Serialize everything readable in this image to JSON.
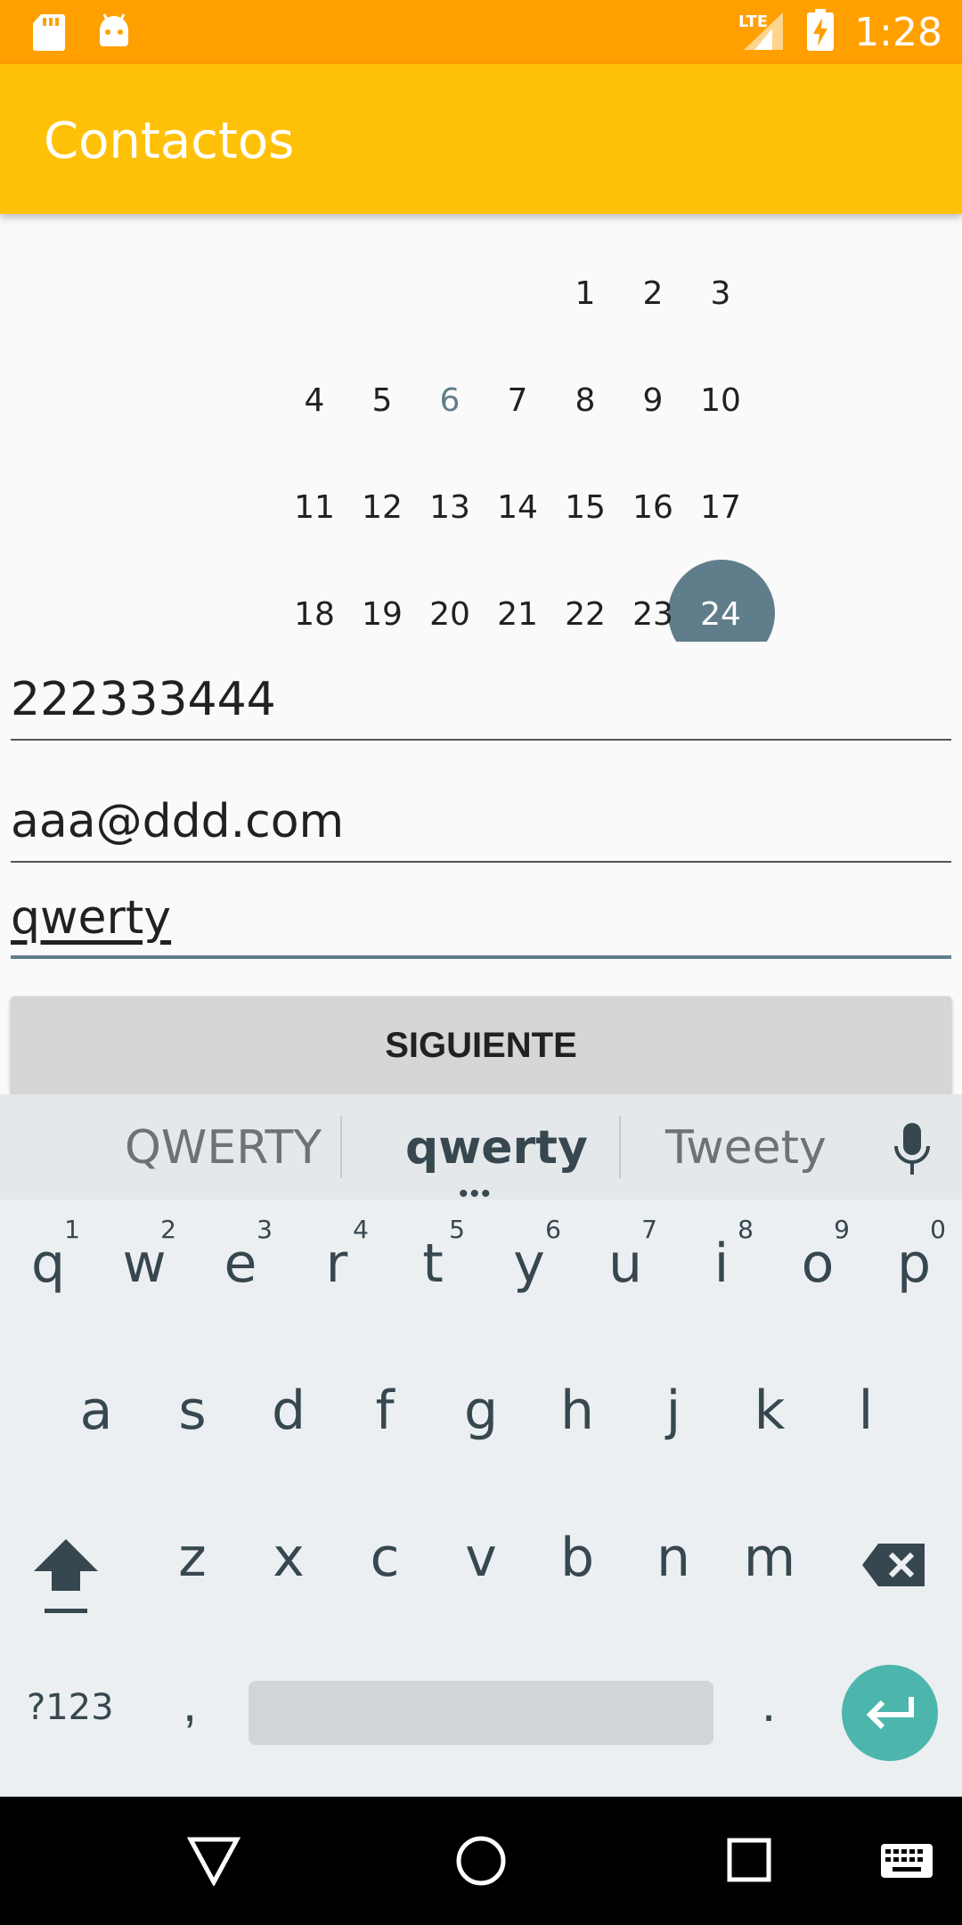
{
  "status_bar": {
    "time": "1:28",
    "network": "LTE",
    "icons": [
      "sd-card-icon",
      "android-icon",
      "signal-icon",
      "battery-charging-icon"
    ]
  },
  "app_bar": {
    "title": "Contactos"
  },
  "calendar": {
    "rows": [
      [
        "",
        "",
        "",
        "",
        "1",
        "2",
        "3"
      ],
      [
        "4",
        "5",
        "6",
        "7",
        "8",
        "9",
        "10"
      ],
      [
        "11",
        "12",
        "13",
        "14",
        "15",
        "16",
        "17"
      ],
      [
        "18",
        "19",
        "20",
        "21",
        "22",
        "23",
        "24"
      ]
    ],
    "today": "6",
    "selected": "24",
    "selected_color": "#607d8b"
  },
  "form": {
    "phone_value": "222333444",
    "email_value": "aaa@ddd.com",
    "description_value": "qwerty",
    "next_label": "SIGUIENTE"
  },
  "keyboard": {
    "suggestions": [
      "QWERTY",
      "qwerty",
      "Tweety"
    ],
    "row1": [
      {
        "l": "q",
        "h": "1"
      },
      {
        "l": "w",
        "h": "2"
      },
      {
        "l": "e",
        "h": "3"
      },
      {
        "l": "r",
        "h": "4"
      },
      {
        "l": "t",
        "h": "5"
      },
      {
        "l": "y",
        "h": "6"
      },
      {
        "l": "u",
        "h": "7"
      },
      {
        "l": "i",
        "h": "8"
      },
      {
        "l": "o",
        "h": "9"
      },
      {
        "l": "p",
        "h": "0"
      }
    ],
    "row2": [
      "a",
      "s",
      "d",
      "f",
      "g",
      "h",
      "j",
      "k",
      "l"
    ],
    "row3": [
      "z",
      "x",
      "c",
      "v",
      "b",
      "n",
      "m"
    ],
    "symbols_label": "?123",
    "comma": ",",
    "period": ".",
    "enter_color": "#4db6ac"
  },
  "colors": {
    "status_bar": "#ffa000",
    "app_bar": "#ffc107",
    "accent": "#607d8b"
  }
}
